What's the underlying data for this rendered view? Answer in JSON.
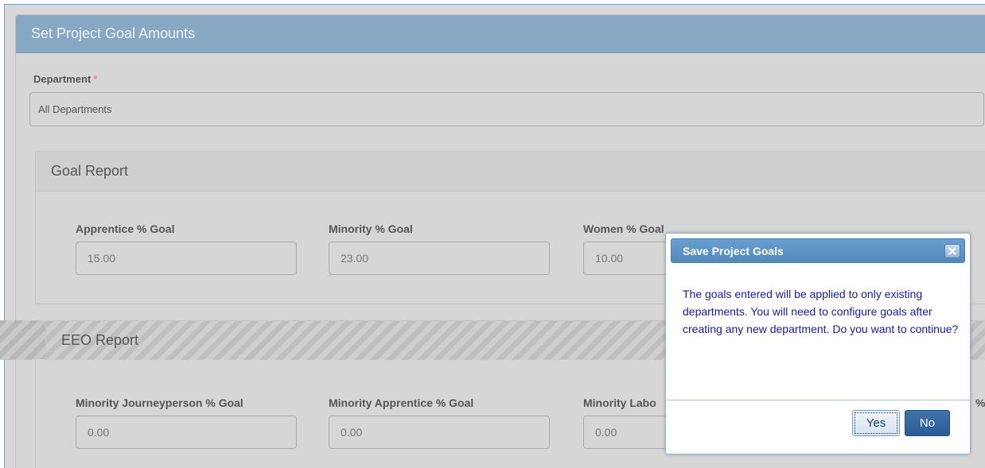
{
  "panel": {
    "title": "Set Project Goal Amounts"
  },
  "department": {
    "label": "Department",
    "required_mark": "*",
    "value": "All Departments"
  },
  "goal_report": {
    "heading": "Goal Report",
    "fields": [
      {
        "label": "Apprentice % Goal",
        "value": "15.00"
      },
      {
        "label": "Minority % Goal",
        "value": "23.00"
      },
      {
        "label": "Women % Goal",
        "value": "10.00"
      }
    ]
  },
  "eeo_report": {
    "heading": "EEO Report",
    "fields": [
      {
        "label": "Minority Journeyperson % Goal",
        "value": "0.00"
      },
      {
        "label": "Minority Apprentice % Goal",
        "value": "0.00"
      },
      {
        "label": "Minority Labo",
        "value": "0.00"
      },
      {
        "label": "%",
        "value": ""
      }
    ]
  },
  "dialog": {
    "title": "Save Project Goals",
    "close_icon": "close-icon",
    "message": "The goals entered will be applied to only existing departments. You will need to configure goals after creating any new department. Do you want to continue?",
    "yes_label": "Yes",
    "no_label": "No"
  },
  "colors": {
    "header_bg": "#87a7c2",
    "dialog_title_bg": "#5b90c5",
    "dialog_text": "#1a1a99",
    "no_button_bg": "#2f629c",
    "required": "#e36f6f"
  }
}
